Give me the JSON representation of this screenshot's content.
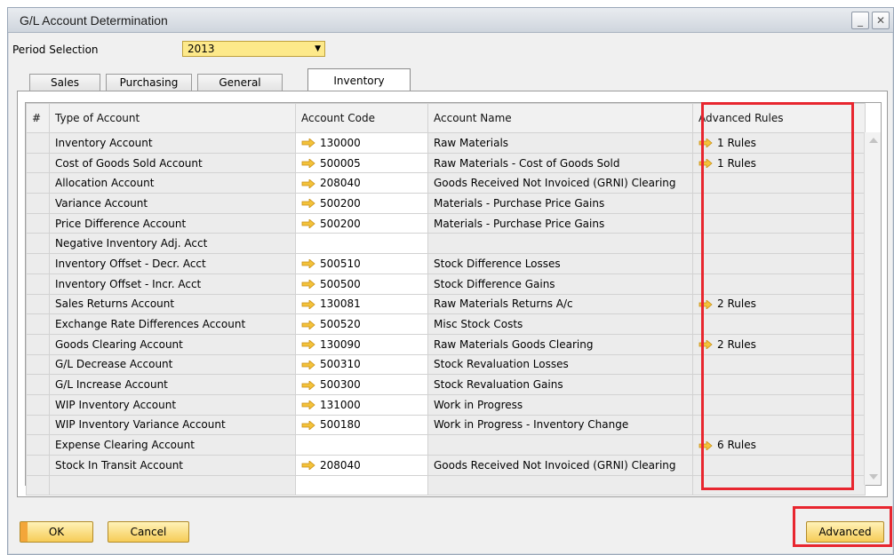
{
  "window": {
    "title": "G/L Account Determination"
  },
  "window_buttons": {
    "minimize": "_",
    "close": "✕"
  },
  "period": {
    "label": "Period Selection",
    "value": "2013"
  },
  "tabs": [
    {
      "label": "Sales",
      "active": false
    },
    {
      "label": "Purchasing",
      "active": false
    },
    {
      "label": "General",
      "active": false
    },
    {
      "label": "Inventory",
      "active": true
    }
  ],
  "grid": {
    "columns": [
      "#",
      "Type of Account",
      "Account Code",
      "Account Name",
      "Advanced Rules"
    ],
    "rows": [
      {
        "type": "Inventory Account",
        "code": "130000",
        "name": "Raw Materials",
        "rules": "1 Rules"
      },
      {
        "type": "Cost of Goods Sold Account",
        "code": "500005",
        "name": "Raw Materials - Cost of Goods Sold",
        "rules": "1 Rules"
      },
      {
        "type": "Allocation Account",
        "code": "208040",
        "name": "Goods Received Not Invoiced (GRNI) Clearing",
        "rules": ""
      },
      {
        "type": "Variance Account",
        "code": "500200",
        "name": "Materials - Purchase Price Gains",
        "rules": ""
      },
      {
        "type": "Price Difference Account",
        "code": "500200",
        "name": "Materials - Purchase Price Gains",
        "rules": ""
      },
      {
        "type": "Negative Inventory Adj. Acct",
        "code": "",
        "name": "",
        "rules": ""
      },
      {
        "type": "Inventory Offset - Decr. Acct",
        "code": "500510",
        "name": "Stock Difference Losses",
        "rules": ""
      },
      {
        "type": "Inventory Offset - Incr. Acct",
        "code": "500500",
        "name": "Stock Difference Gains",
        "rules": ""
      },
      {
        "type": "Sales Returns Account",
        "code": "130081",
        "name": "Raw Materials Returns A/c",
        "rules": "2 Rules"
      },
      {
        "type": "Exchange Rate Differences Account",
        "code": "500520",
        "name": "Misc Stock Costs",
        "rules": ""
      },
      {
        "type": "Goods Clearing Account",
        "code": "130090",
        "name": "Raw Materials Goods Clearing",
        "rules": "2 Rules"
      },
      {
        "type": "G/L Decrease Account",
        "code": "500310",
        "name": "Stock Revaluation Losses",
        "rules": ""
      },
      {
        "type": "G/L Increase Account",
        "code": "500300",
        "name": "Stock Revaluation Gains",
        "rules": ""
      },
      {
        "type": "WIP Inventory Account",
        "code": "131000",
        "name": "Work in Progress",
        "rules": ""
      },
      {
        "type": "WIP Inventory Variance Account",
        "code": "500180",
        "name": "Work in Progress - Inventory Change",
        "rules": ""
      },
      {
        "type": "Expense Clearing Account",
        "code": "",
        "name": "",
        "rules": "6 Rules"
      },
      {
        "type": "Stock In Transit Account",
        "code": "208040",
        "name": "Goods Received Not Invoiced (GRNI) Clearing",
        "rules": ""
      },
      {
        "type": "",
        "code": "",
        "name": "",
        "rules": ""
      }
    ]
  },
  "buttons": {
    "ok": "OK",
    "cancel": "Cancel",
    "advanced": "Advanced"
  },
  "colors": {
    "link_arrow": "#f3c23a",
    "highlight": "#e8262f",
    "button_fill": "#f6cc57",
    "period_field": "#fde98a"
  }
}
